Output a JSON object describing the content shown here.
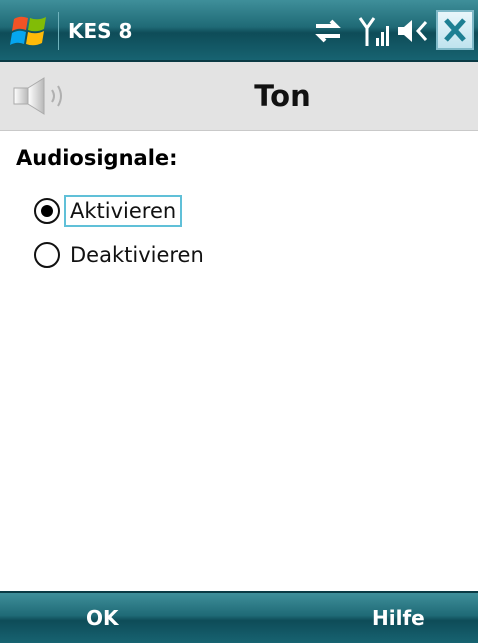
{
  "titlebar": {
    "app_title": "KES 8",
    "icons": [
      "windows-start-icon",
      "connectivity-icon",
      "signal-icon",
      "volume-icon",
      "close-icon"
    ],
    "close_glyph": "✕"
  },
  "header": {
    "title": "Ton",
    "icon": "speaker-icon"
  },
  "main": {
    "group_label": "Audiosignale:",
    "options": [
      {
        "label": "Aktivieren",
        "selected": true
      },
      {
        "label": "Deaktivieren",
        "selected": false
      }
    ]
  },
  "softkeys": {
    "left": "OK",
    "right": "Hilfe"
  },
  "colors": {
    "bar_dark": "#0e4c58",
    "bar_light": "#3f8f9a",
    "focus": "#60c0d8"
  }
}
